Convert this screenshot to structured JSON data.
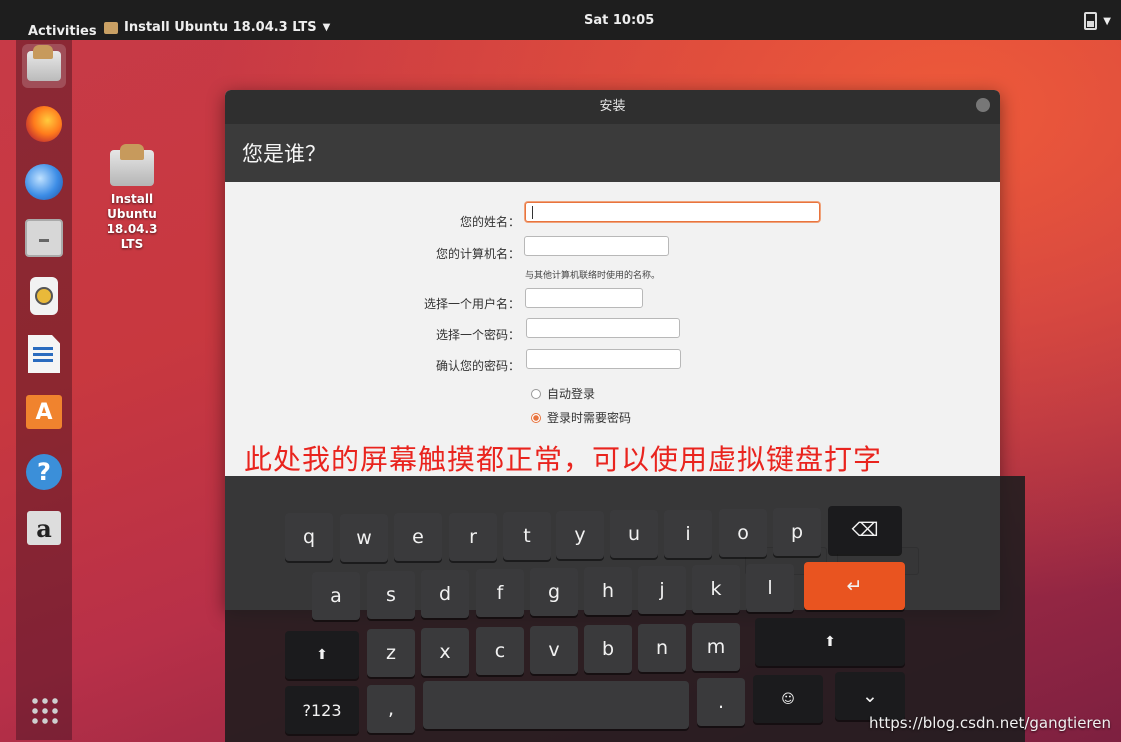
{
  "topbar": {
    "activities": "Activities",
    "app_menu": "Install Ubuntu 18.04.3 LTS",
    "clock": "Sat 10:05"
  },
  "desktop_icon": {
    "line1": "Install",
    "line2": "Ubuntu",
    "line3": "18.04.3 LTS"
  },
  "window": {
    "title": "安装",
    "heading": "您是谁？",
    "fields": {
      "name_label": "您的姓名：",
      "name_value": "",
      "computer_label": "您的计算机名：",
      "computer_value": "",
      "computer_hint": "与其他计算机联络时使用的名称。",
      "username_label": "选择一个用户名：",
      "username_value": "",
      "password_label": "选择一个密码：",
      "password_value": "",
      "confirm_label": "确认您的密码：",
      "confirm_value": ""
    },
    "login_options": {
      "auto_login": "自动登录",
      "require_password": "登录时需要密码",
      "selected": "require_password"
    }
  },
  "annotation": "此处我的屏幕触摸都正常，可以使用虚拟键盘打字",
  "keyboard": {
    "row1": [
      "q",
      "w",
      "e",
      "r",
      "t",
      "y",
      "u",
      "i",
      "o",
      "p"
    ],
    "row2": [
      "a",
      "s",
      "d",
      "f",
      "g",
      "h",
      "j",
      "k",
      "l"
    ],
    "row3": [
      "z",
      "x",
      "c",
      "v",
      "b",
      "n",
      "m"
    ],
    "backspace": "⌫",
    "enter": "↵",
    "shift": "⬆",
    "numbers": "?123",
    "comma": ",",
    "period": ".",
    "hide": "⌄"
  },
  "watermark": "https://blog.csdn.net/gangtieren",
  "colors": {
    "accent": "#e95420",
    "annotation": "#e9241e"
  }
}
